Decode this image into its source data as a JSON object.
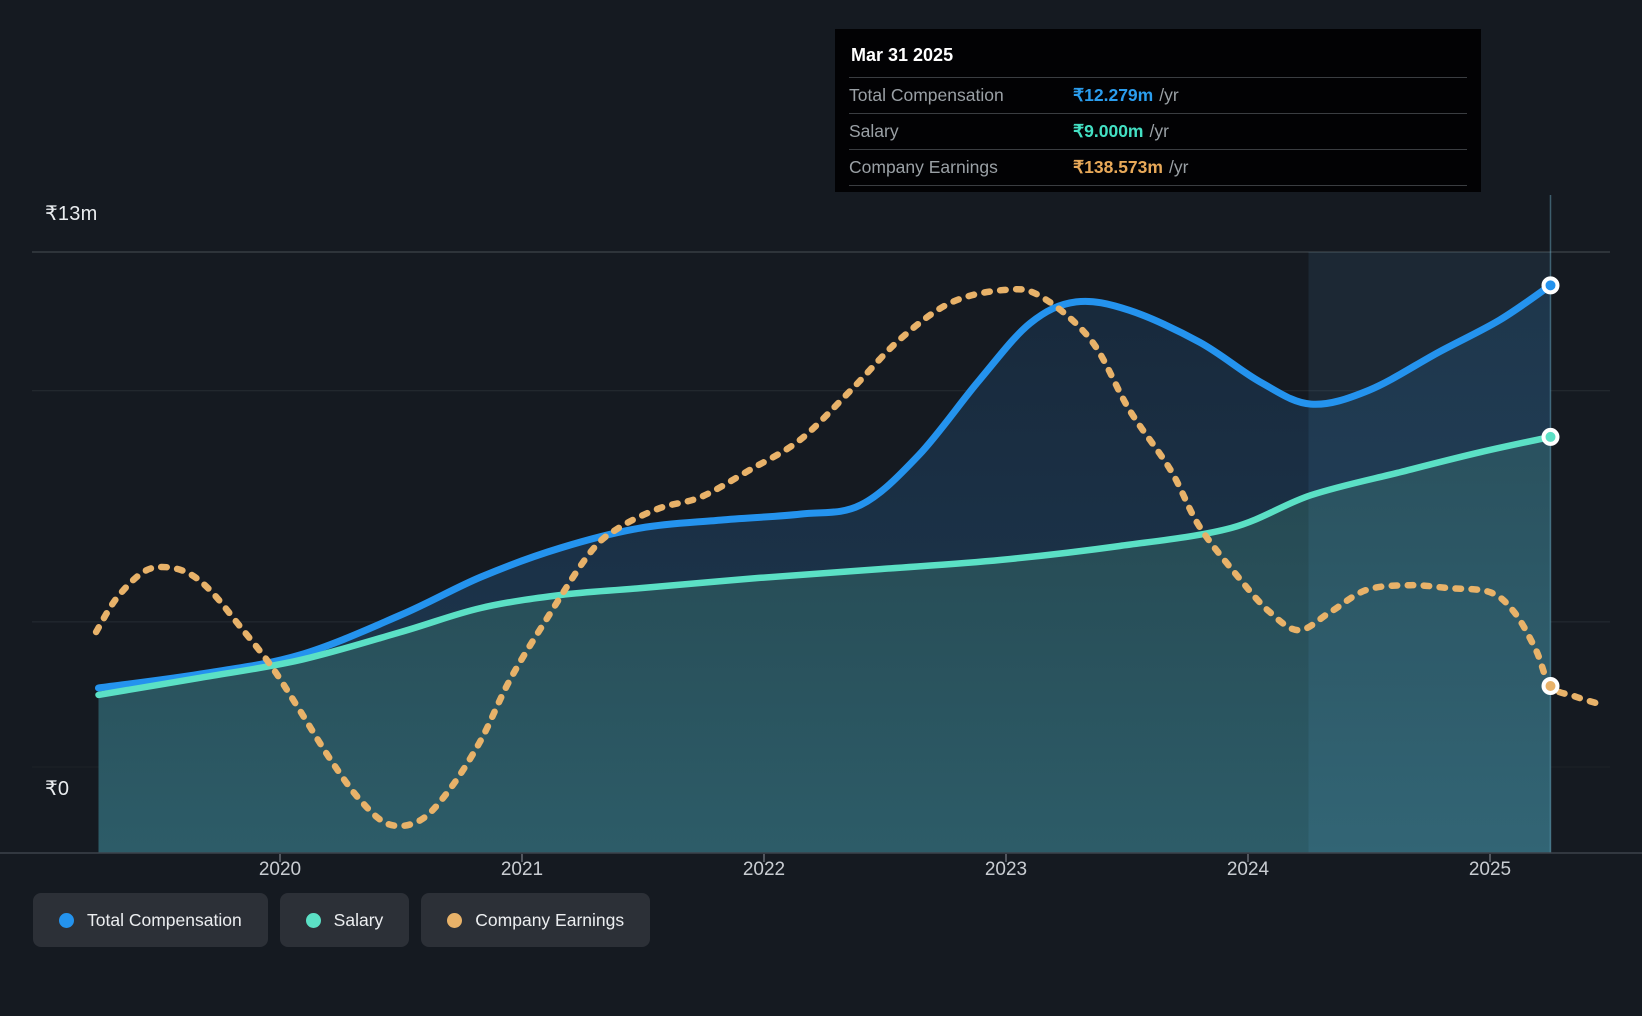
{
  "tooltip": {
    "date": "Mar 31 2025",
    "rows": [
      {
        "label": "Total Compensation",
        "value": "₹12.279m",
        "unit": "/yr"
      },
      {
        "label": "Salary",
        "value": "₹9.000m",
        "unit": "/yr"
      },
      {
        "label": "Company Earnings",
        "value": "₹138.573m",
        "unit": "/yr"
      }
    ]
  },
  "y_axis": {
    "top_label": "₹13m",
    "zero_label": "₹0"
  },
  "x_axis": {
    "years": [
      "2020",
      "2021",
      "2022",
      "2023",
      "2024",
      "2025"
    ]
  },
  "legend": [
    {
      "label": "Total Compensation"
    },
    {
      "label": "Salary"
    },
    {
      "label": "Company Earnings"
    }
  ],
  "colors": {
    "background": "#151a21",
    "total_compensation": "#2493ee",
    "salary": "#5be0c5",
    "earnings": "#e8b269",
    "tooltip_value_blue": "#2b9ded",
    "tooltip_value_teal": "#43e0c3",
    "tooltip_value_orange": "#e8a959",
    "grid": "#262c33",
    "grid_top": "#363c43",
    "axis": "#3d424a"
  },
  "chart_data": {
    "type": "line",
    "y_units": "INR millions per year",
    "ylim": [
      0,
      13
    ],
    "x_range": [
      2019.25,
      2025.45
    ],
    "gridline_values_m": [
      5,
      10,
      13
    ],
    "highlight_period": {
      "from": 2024.25,
      "to": 2025.25
    },
    "tooltip_point": {
      "date": "Mar 31 2025",
      "total_compensation_m": 12.279,
      "salary_m": 9.0,
      "company_earnings_m": 138.573
    },
    "series": [
      {
        "name": "Total Compensation",
        "style": "solid",
        "units": "₹m/yr",
        "points": [
          [
            2019.25,
            3.57
          ],
          [
            2019.67,
            3.87
          ],
          [
            2020.08,
            4.28
          ],
          [
            2020.5,
            5.15
          ],
          [
            2020.83,
            5.97
          ],
          [
            2021.16,
            6.6
          ],
          [
            2021.49,
            7.03
          ],
          [
            2021.82,
            7.2
          ],
          [
            2022.15,
            7.33
          ],
          [
            2022.4,
            7.53
          ],
          [
            2022.64,
            8.61
          ],
          [
            2022.89,
            10.23
          ],
          [
            2023.1,
            11.46
          ],
          [
            2023.29,
            11.92
          ],
          [
            2023.51,
            11.74
          ],
          [
            2023.8,
            11.05
          ],
          [
            2024.05,
            10.19
          ],
          [
            2024.26,
            9.71
          ],
          [
            2024.5,
            10.01
          ],
          [
            2024.79,
            10.84
          ],
          [
            2025.04,
            11.53
          ],
          [
            2025.25,
            12.279
          ]
        ]
      },
      {
        "name": "Salary",
        "style": "solid",
        "units": "₹m/yr",
        "points": [
          [
            2019.25,
            3.42
          ],
          [
            2019.67,
            3.79
          ],
          [
            2020.08,
            4.17
          ],
          [
            2020.5,
            4.78
          ],
          [
            2020.83,
            5.3
          ],
          [
            2021.16,
            5.58
          ],
          [
            2021.49,
            5.73
          ],
          [
            2021.98,
            5.95
          ],
          [
            2022.48,
            6.14
          ],
          [
            2022.98,
            6.34
          ],
          [
            2023.47,
            6.64
          ],
          [
            2023.93,
            7.03
          ],
          [
            2024.26,
            7.74
          ],
          [
            2024.63,
            8.24
          ],
          [
            2024.96,
            8.67
          ],
          [
            2025.25,
            9.0
          ]
        ]
      },
      {
        "name": "Company Earnings",
        "style": "dotted",
        "units": "₹m/yr (own scale, values estimated; last point labeled 138.573)",
        "points": [
          [
            2019.24,
            231
          ],
          [
            2019.32,
            286
          ],
          [
            2019.42,
            329
          ],
          [
            2019.5,
            342
          ],
          [
            2019.61,
            334
          ],
          [
            2019.71,
            303
          ],
          [
            2019.83,
            243
          ],
          [
            2019.96,
            175
          ],
          [
            2020.08,
            98
          ],
          [
            2020.21,
            12
          ],
          [
            2020.33,
            -56
          ],
          [
            2020.45,
            -98
          ],
          [
            2020.58,
            -91
          ],
          [
            2020.7,
            -39
          ],
          [
            2020.83,
            46
          ],
          [
            2020.95,
            149
          ],
          [
            2021.1,
            252
          ],
          [
            2021.28,
            366
          ],
          [
            2021.4,
            409
          ],
          [
            2021.57,
            443
          ],
          [
            2021.74,
            462
          ],
          [
            2021.94,
            508
          ],
          [
            2022.15,
            560
          ],
          [
            2022.36,
            645
          ],
          [
            2022.56,
            731
          ],
          [
            2022.77,
            794
          ],
          [
            2022.99,
            816
          ],
          [
            2023.14,
            806
          ],
          [
            2023.35,
            731
          ],
          [
            2023.51,
            611
          ],
          [
            2023.68,
            508
          ],
          [
            2023.8,
            411
          ],
          [
            2023.97,
            320
          ],
          [
            2024.09,
            265
          ],
          [
            2024.21,
            234
          ],
          [
            2024.34,
            265
          ],
          [
            2024.49,
            303
          ],
          [
            2024.67,
            311
          ],
          [
            2024.83,
            306
          ],
          [
            2025.0,
            299
          ],
          [
            2025.1,
            265
          ],
          [
            2025.19,
            200
          ],
          [
            2025.25,
            138.573
          ],
          [
            2025.35,
            121
          ],
          [
            2025.45,
            108
          ]
        ]
      }
    ]
  }
}
